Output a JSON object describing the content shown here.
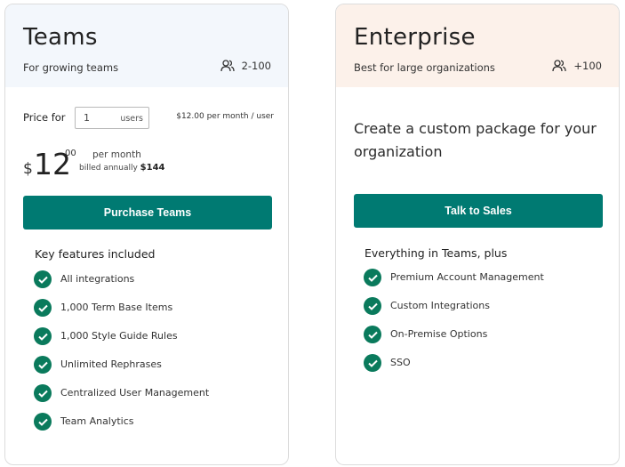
{
  "colors": {
    "accent": "#007a72",
    "check": "#0a7a5c",
    "teams_header_bg": "#f3f7fc",
    "enterprise_header_bg": "#fcf1ea"
  },
  "teams": {
    "title": "Teams",
    "subtitle": "For growing teams",
    "seats": "2-100",
    "seats_icon": "users-icon",
    "price_label": "Price for",
    "quantity_value": "1",
    "quantity_unit": "users",
    "per_user_price": "$12.00 per month / user",
    "currency": "$",
    "price_whole": "12",
    "price_cents": "00",
    "price_period": "per month",
    "billed_prefix": "billed annually",
    "billed_amount": "$144",
    "cta_label": "Purchase Teams",
    "features_title": "Key features included",
    "features": [
      "All integrations",
      "1,000 Term Base Items",
      "1,000 Style Guide Rules",
      "Unlimited Rephrases",
      "Centralized User Management",
      "Team Analytics"
    ]
  },
  "enterprise": {
    "title": "Enterprise",
    "subtitle": "Best for large organizations",
    "seats": "+100",
    "seats_icon": "users-icon",
    "custom_text": "Create a custom package for your organization",
    "cta_label": "Talk to Sales",
    "features_title": "Everything in Teams, plus",
    "features": [
      "Premium Account Management",
      "Custom Integrations",
      "On-Premise Options",
      "SSO"
    ]
  }
}
